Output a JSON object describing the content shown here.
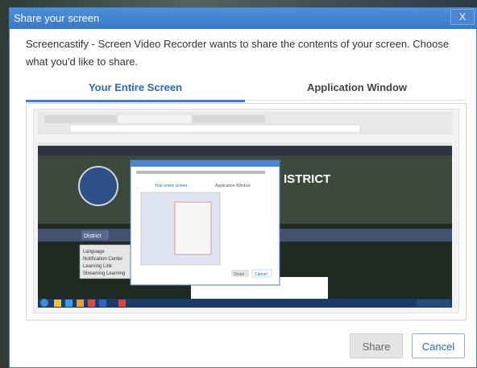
{
  "window": {
    "title": "Share your screen",
    "close_glyph": "X"
  },
  "prompt": "Screencastify - Screen Video Recorder wants to share the contents of your screen. Choose what you'd like to share.",
  "tabs": [
    {
      "label": "Your Entire Screen",
      "selected": true
    },
    {
      "label": "Application Window",
      "selected": false
    }
  ],
  "preview": {
    "site_banner": "ISTRICT",
    "site_nav_button": "District",
    "menu_items": [
      "Language",
      "Notification Center",
      "Learning Link",
      "Streaming Learning"
    ],
    "mini_dialog_tabs": [
      "Your entire screen",
      "Application Window"
    ],
    "mini_dialog_buttons": [
      "Share",
      "Cancel"
    ]
  },
  "buttons": {
    "share": "Share",
    "cancel": "Cancel"
  },
  "colors": {
    "accent": "#3b7dd8",
    "titlebar": "#4282d2"
  }
}
